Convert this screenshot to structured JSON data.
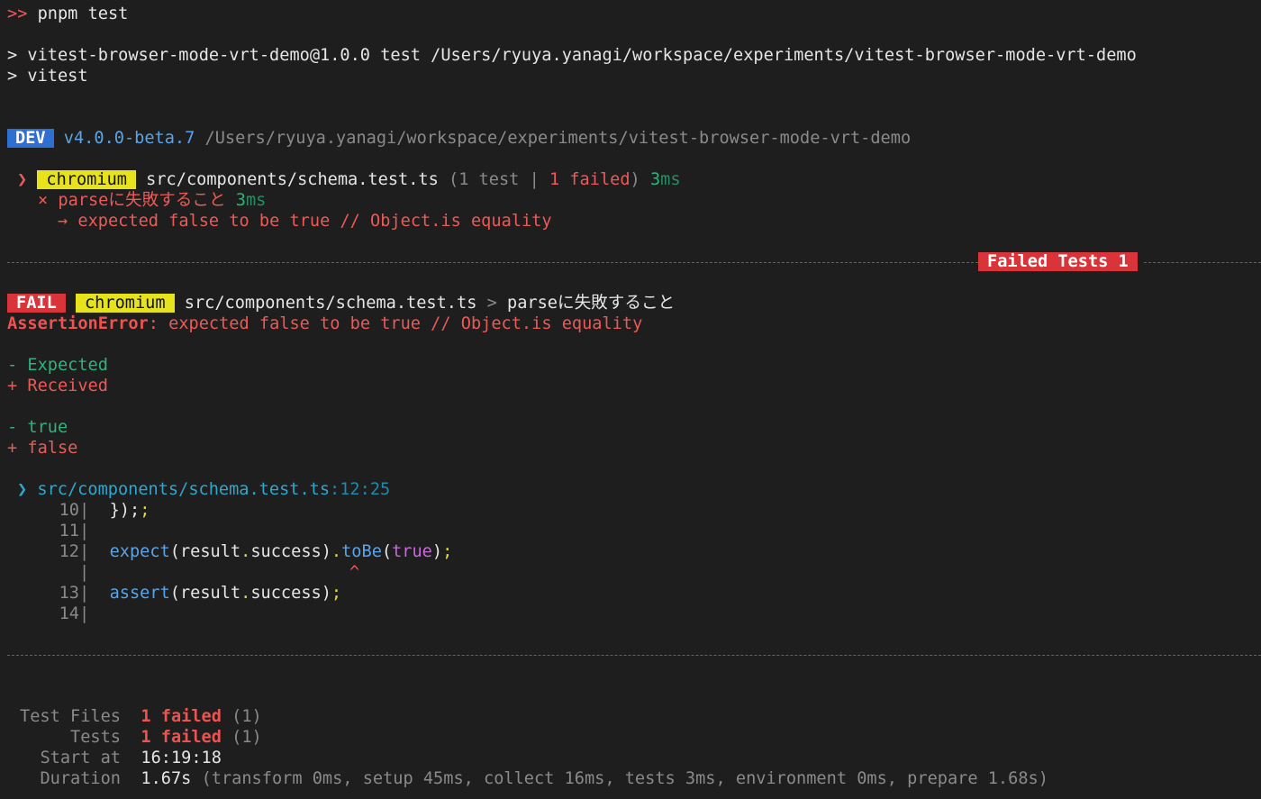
{
  "top_cut": {
    "prompt": ">>",
    "command": "pnpm test"
  },
  "script_info": {
    "line1": "> vitest-browser-mode-vrt-demo@1.0.0 test /Users/ryuya.yanagi/workspace/experiments/vitest-browser-mode-vrt-demo",
    "line2": "> vitest"
  },
  "dev_line": {
    "badge": "DEV",
    "version": "v4.0.0-beta.7",
    "path": "/Users/ryuya.yanagi/workspace/experiments/vitest-browser-mode-vrt-demo"
  },
  "suite": {
    "chevron": "❯",
    "browser": "chromium",
    "file": "src/components/schema.test.ts",
    "count_open": "(1 test | ",
    "failed_text": "1 failed",
    "count_close": ")",
    "duration_num": "3",
    "duration_unit": "ms"
  },
  "test_case": {
    "marker": "×",
    "name": "parseに失敗すること",
    "duration_num": "3",
    "duration_unit": "ms",
    "arrow": "→",
    "message": "expected false to be true // Object.is equality"
  },
  "separator": {
    "label": "Failed Tests 1"
  },
  "fail_header": {
    "badge": "FAIL",
    "browser": "chromium",
    "file": "src/components/schema.test.ts",
    "gt": ">",
    "name": "parseに失敗すること"
  },
  "assertion": {
    "type": "AssertionError",
    "message": ": expected false to be true // Object.is equality"
  },
  "diff": {
    "expected_label": "- Expected",
    "received_label": "+ Received",
    "expected_value": "- true",
    "received_value": "+ false"
  },
  "location": {
    "chevron": "❯",
    "file": "src/components/schema.test.ts",
    "position": ":12:25"
  },
  "code": [
    {
      "num": "10",
      "text": "  });"
    },
    {
      "num": "11",
      "text": ""
    },
    {
      "num": "12",
      "text": "  expect(result.success).toBe(true);"
    },
    {
      "num": "",
      "text": "^"
    },
    {
      "num": "13",
      "text": "  assert(result.success);"
    },
    {
      "num": "14",
      "text": ""
    }
  ],
  "summary": {
    "files_label": "Test Files",
    "files_failed": "1 failed",
    "files_total": "(1)",
    "tests_label": "Tests",
    "tests_failed": "1 failed",
    "tests_total": "(1)",
    "start_label": "Start at",
    "start_value": "16:19:18",
    "duration_label": "Duration",
    "duration_value": "1.67s",
    "duration_detail": "(transform 0ms, setup 45ms, collect 16ms, tests 3ms, environment 0ms, prepare 1.68s)"
  },
  "colors": {
    "background": "#1e1e1e",
    "error": "#ec5a57",
    "success": "#2fb37c",
    "dev_badge": "#2f6fd1",
    "browser_badge": "#e6e21c",
    "fail_badge": "#d8343a"
  }
}
